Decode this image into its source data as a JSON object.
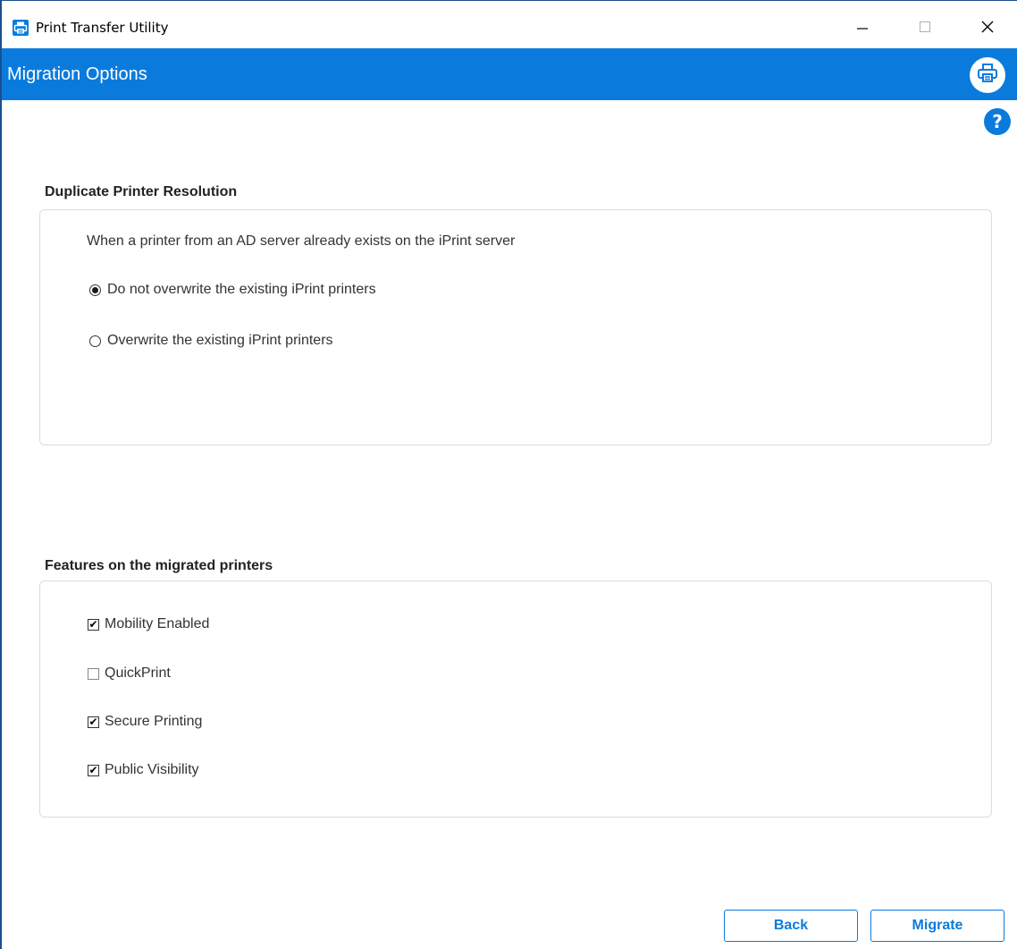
{
  "window": {
    "title": "Print Transfer Utility",
    "controls": {
      "minimize": "minimize-icon",
      "maximize": "maximize-icon",
      "close": "close-icon"
    }
  },
  "header": {
    "title": "Migration Options",
    "accent_color": "#0a7bdc",
    "printer_icon": "printer-icon"
  },
  "help": {
    "label": "?"
  },
  "duplicate": {
    "heading": "Duplicate Printer Resolution",
    "description": "When a printer from an AD server already exists on the iPrint server",
    "options": [
      {
        "label": "Do not overwrite the existing iPrint printers",
        "selected": true
      },
      {
        "label": "Overwrite the existing iPrint printers",
        "selected": false
      }
    ]
  },
  "features": {
    "heading": "Features on the migrated printers",
    "items": [
      {
        "label": "Mobility Enabled",
        "checked": true
      },
      {
        "label": "QuickPrint",
        "checked": false
      },
      {
        "label": "Secure Printing",
        "checked": true
      },
      {
        "label": "Public Visibility",
        "checked": true
      }
    ]
  },
  "footer": {
    "back_label": "Back",
    "migrate_label": "Migrate"
  }
}
